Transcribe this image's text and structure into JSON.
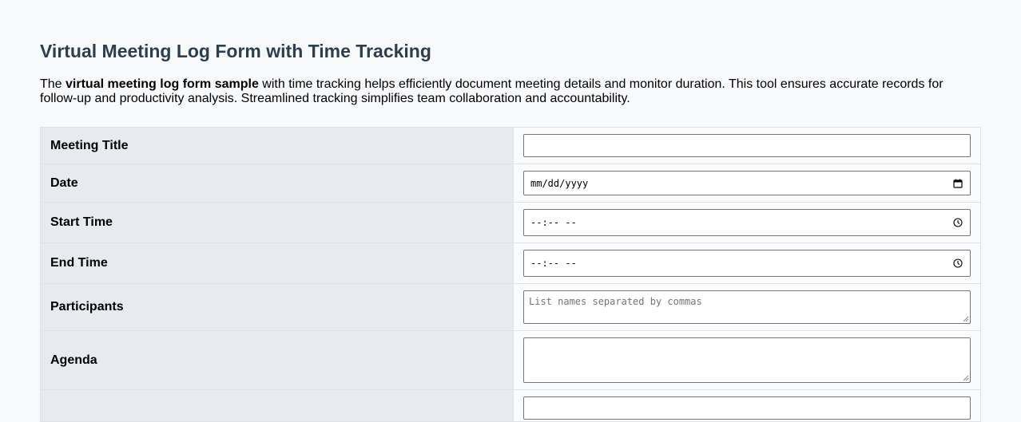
{
  "page": {
    "title": "Virtual Meeting Log Form with Time Tracking",
    "intro": {
      "prefix": "The ",
      "bold": "virtual meeting log form sample",
      "suffix": " with time tracking helps efficiently document meeting details and monitor duration. This tool ensures accurate records for follow-up and productivity analysis. Streamlined tracking simplifies team collaboration and accountability."
    }
  },
  "form": {
    "meeting_title": {
      "label": "Meeting Title",
      "value": ""
    },
    "date": {
      "label": "Date",
      "placeholder": "mm/dd/yyyy",
      "icon": "calendar-icon"
    },
    "start_time": {
      "label": "Start Time",
      "placeholder": "--:-- --",
      "icon": "clock-icon"
    },
    "end_time": {
      "label": "End Time",
      "placeholder": "--:-- --",
      "icon": "clock-icon"
    },
    "participants": {
      "label": "Participants",
      "placeholder": "List names separated by commas"
    },
    "agenda": {
      "label": "Agenda",
      "value": ""
    }
  },
  "colors": {
    "title": "#2c3e50",
    "label_bg": "#e7eaee",
    "page_bg": "#f8f9fb",
    "input_border": "#767676"
  }
}
